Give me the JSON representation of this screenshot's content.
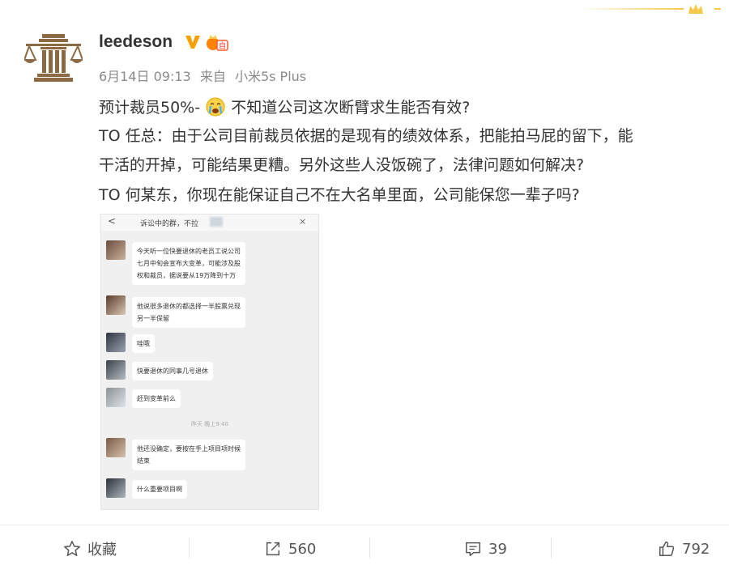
{
  "post": {
    "username": "leedeson",
    "date": "6月14日 09:13",
    "source_prefix": "来自",
    "source_device": "小米5s Plus",
    "icons": [
      "scales-avatar-icon",
      "verified-v-icon",
      "vip-badge-icon",
      "crying-emoji-icon"
    ],
    "lines": {
      "l1_before": "预计裁员50%-",
      "l1_after": "不知道公司这次断臂求生能否有效?",
      "l2": "TO 任总：由于公司目前裁员依据的是现有的绩效体系，把能拍马屁的留下，能",
      "l3": "干活的开掉，可能结果更糟。另外这些人没饭碗了，法律问题如何解决?",
      "l4": "TO 何某东，你现在能保证自己不在大名单里面，公司能保您一辈子吗?"
    }
  },
  "screenshot": {
    "back": "<",
    "title": "诉讼中的群，不拉",
    "close": "×",
    "messages": [
      "今天听一位快要退休的老员工说公司\n七月中旬会宣布大变革，可能涉及股\n权和裁员，据说要从19万降到十万",
      "他说很多退休的都选择一半股票兑现\n另一半保留",
      "哇哦",
      "快要退休的同事几号退休",
      "赶到变革前么",
      "他还没确定，要按在手上项目项时候\n结束",
      "什么重要项目啊"
    ],
    "time": "昨天 晚上9:40"
  },
  "actions": {
    "favorite": "收藏",
    "repost": "560",
    "comment": "39",
    "like": "792"
  },
  "colors": {
    "gold": "#f5c94a",
    "badge_orange": "#ff8200",
    "avatar_brown": "#8b6a44"
  }
}
